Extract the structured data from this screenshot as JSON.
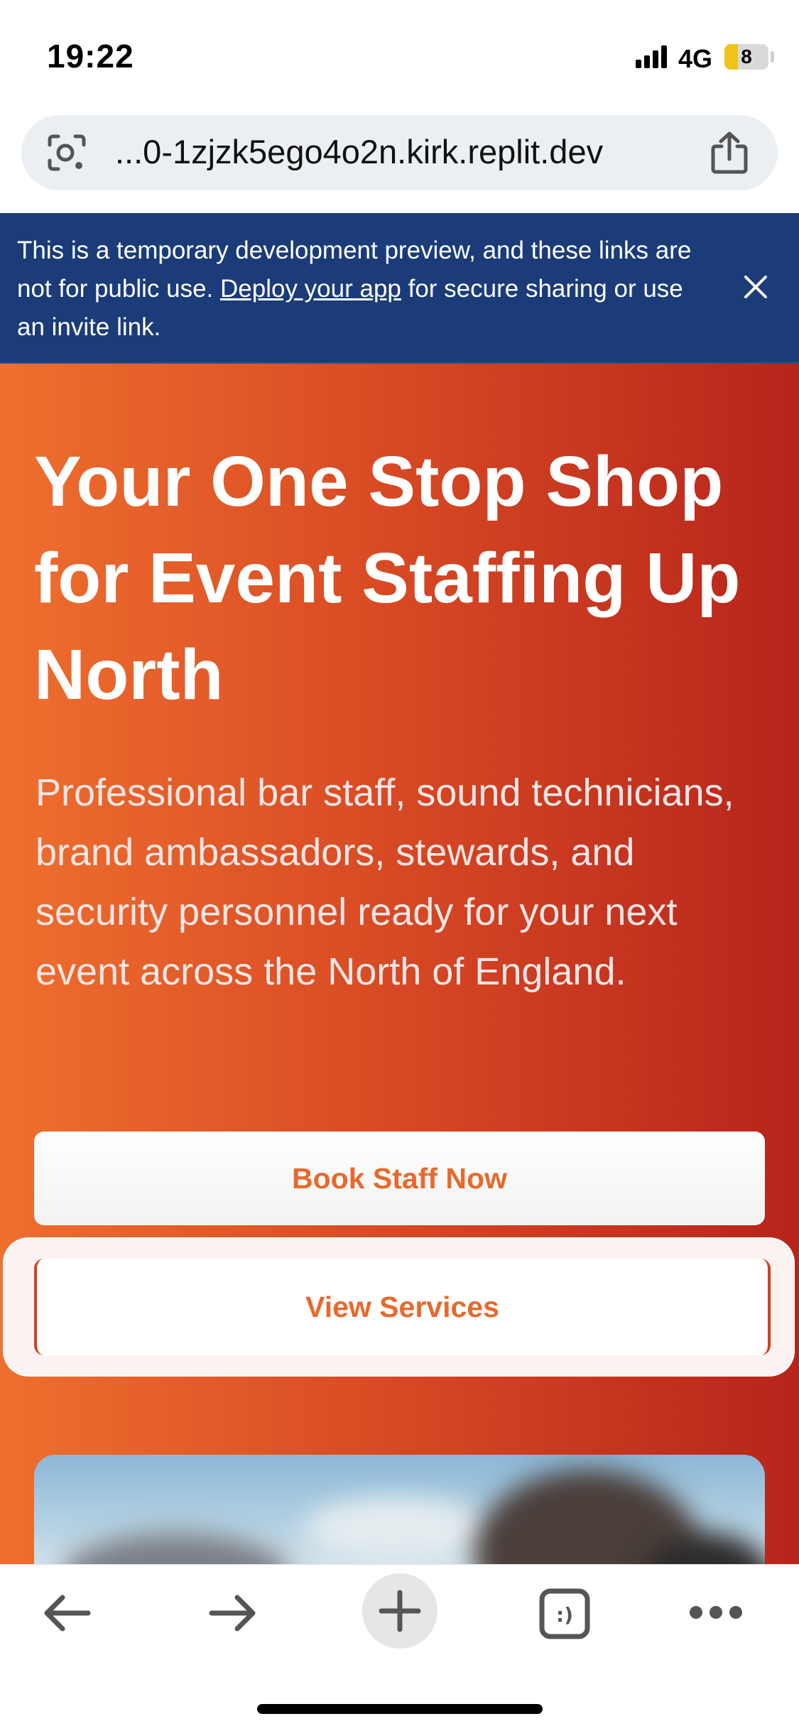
{
  "status_bar": {
    "time": "19:22",
    "network": "4G",
    "battery": "8",
    "battery_level_percent": 8
  },
  "address_bar": {
    "url": "...0-1zjzk5ego4o2n.kirk.replit.dev",
    "left_icon": "lens-icon",
    "right_icon": "share-icon"
  },
  "dev_banner": {
    "text_before": "This is a temporary development preview, and these links are not for public use. ",
    "link": "Deploy your app",
    "text_after": " for secure sharing or use an invite link.",
    "close_icon": "close-icon",
    "background": "#1b3c78"
  },
  "hero": {
    "title": "Your One Stop Shop for Event Staffing Up North",
    "subtitle": "Professional bar staff, sound technicians, brand ambassadors, stewards, and security personnel ready for your next event across the North of England.",
    "primary_button": "Book Staff Now",
    "secondary_button": "View Services",
    "gradient_start": "#ee6f2e",
    "gradient_end": "#b7241b",
    "button_text_color": "#e8692c"
  },
  "toolbar": {
    "icons": [
      "back-arrow-icon",
      "forward-arrow-icon",
      "new-tab-plus-icon",
      "tabs-icon",
      "more-icon"
    ],
    "tabs_glyph": ":)"
  }
}
